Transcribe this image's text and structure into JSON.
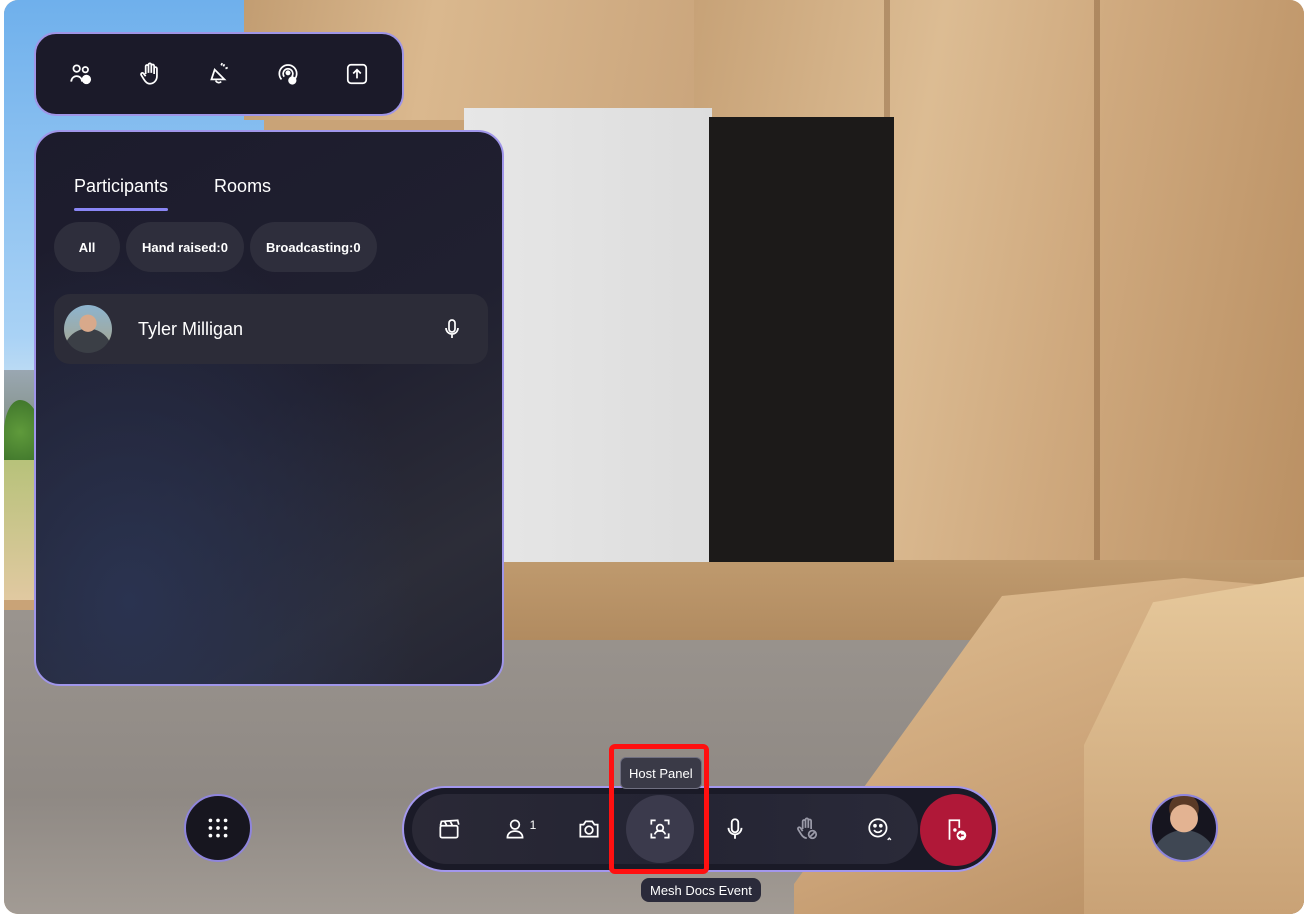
{
  "top_toolbar": {
    "icons": [
      "people-manage-icon",
      "raise-hand-icon",
      "megaphone-icon",
      "broadcast-icon",
      "share-icon"
    ]
  },
  "panel": {
    "tabs": [
      {
        "label": "Participants",
        "active": true
      },
      {
        "label": "Rooms",
        "active": false
      }
    ],
    "filters": [
      "All",
      "Hand raised:0",
      "Broadcasting:0"
    ],
    "participants": [
      {
        "name": "Tyler Milligan",
        "mic": "mic-icon"
      }
    ]
  },
  "bottom_bar": {
    "participant_count": "1",
    "host_panel_tooltip": "Host Panel",
    "event_name": "Mesh Docs Event",
    "buttons": [
      "clapperboard-icon",
      "participants-icon",
      "camera-icon",
      "host-panel-icon",
      "mic-icon",
      "hand-off-icon",
      "emoji-icon",
      "leave-icon"
    ]
  },
  "colors": {
    "accent_border": "#a096ea",
    "leave_red": "#b01838",
    "highlight_red": "#ff1010"
  }
}
